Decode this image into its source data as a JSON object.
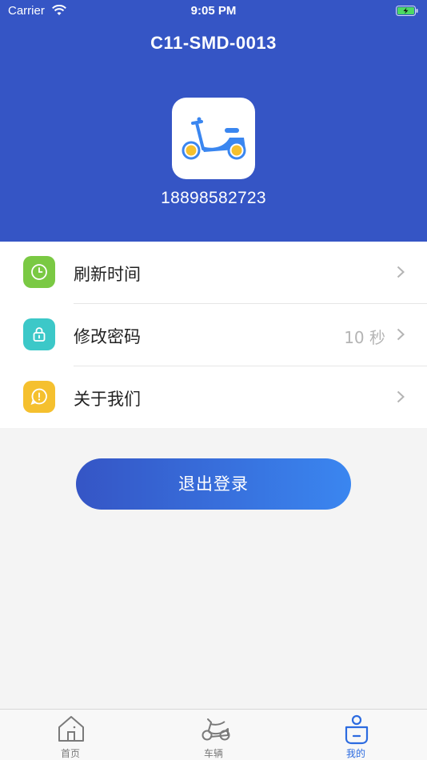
{
  "status_bar": {
    "carrier": "Carrier",
    "time": "9:05 PM"
  },
  "header": {
    "title": "C11-SMD-0013",
    "phone": "18898582723"
  },
  "menu": [
    {
      "label": "刷新时间",
      "value": "",
      "icon": "clock-icon",
      "color": "#7ac943"
    },
    {
      "label": "修改密码",
      "value": "10 秒",
      "icon": "lock-icon",
      "color": "#3cc8c8"
    },
    {
      "label": "关于我们",
      "value": "",
      "icon": "info-icon",
      "color": "#f5c02e"
    }
  ],
  "logout_label": "退出登录",
  "tabbar": [
    {
      "label": "首页",
      "icon": "home-icon",
      "active": false
    },
    {
      "label": "车辆",
      "icon": "scooter-icon",
      "active": false
    },
    {
      "label": "我的",
      "icon": "profile-icon",
      "active": true
    }
  ],
  "colors": {
    "primary": "#3555c5",
    "accent": "#3a86f0"
  }
}
